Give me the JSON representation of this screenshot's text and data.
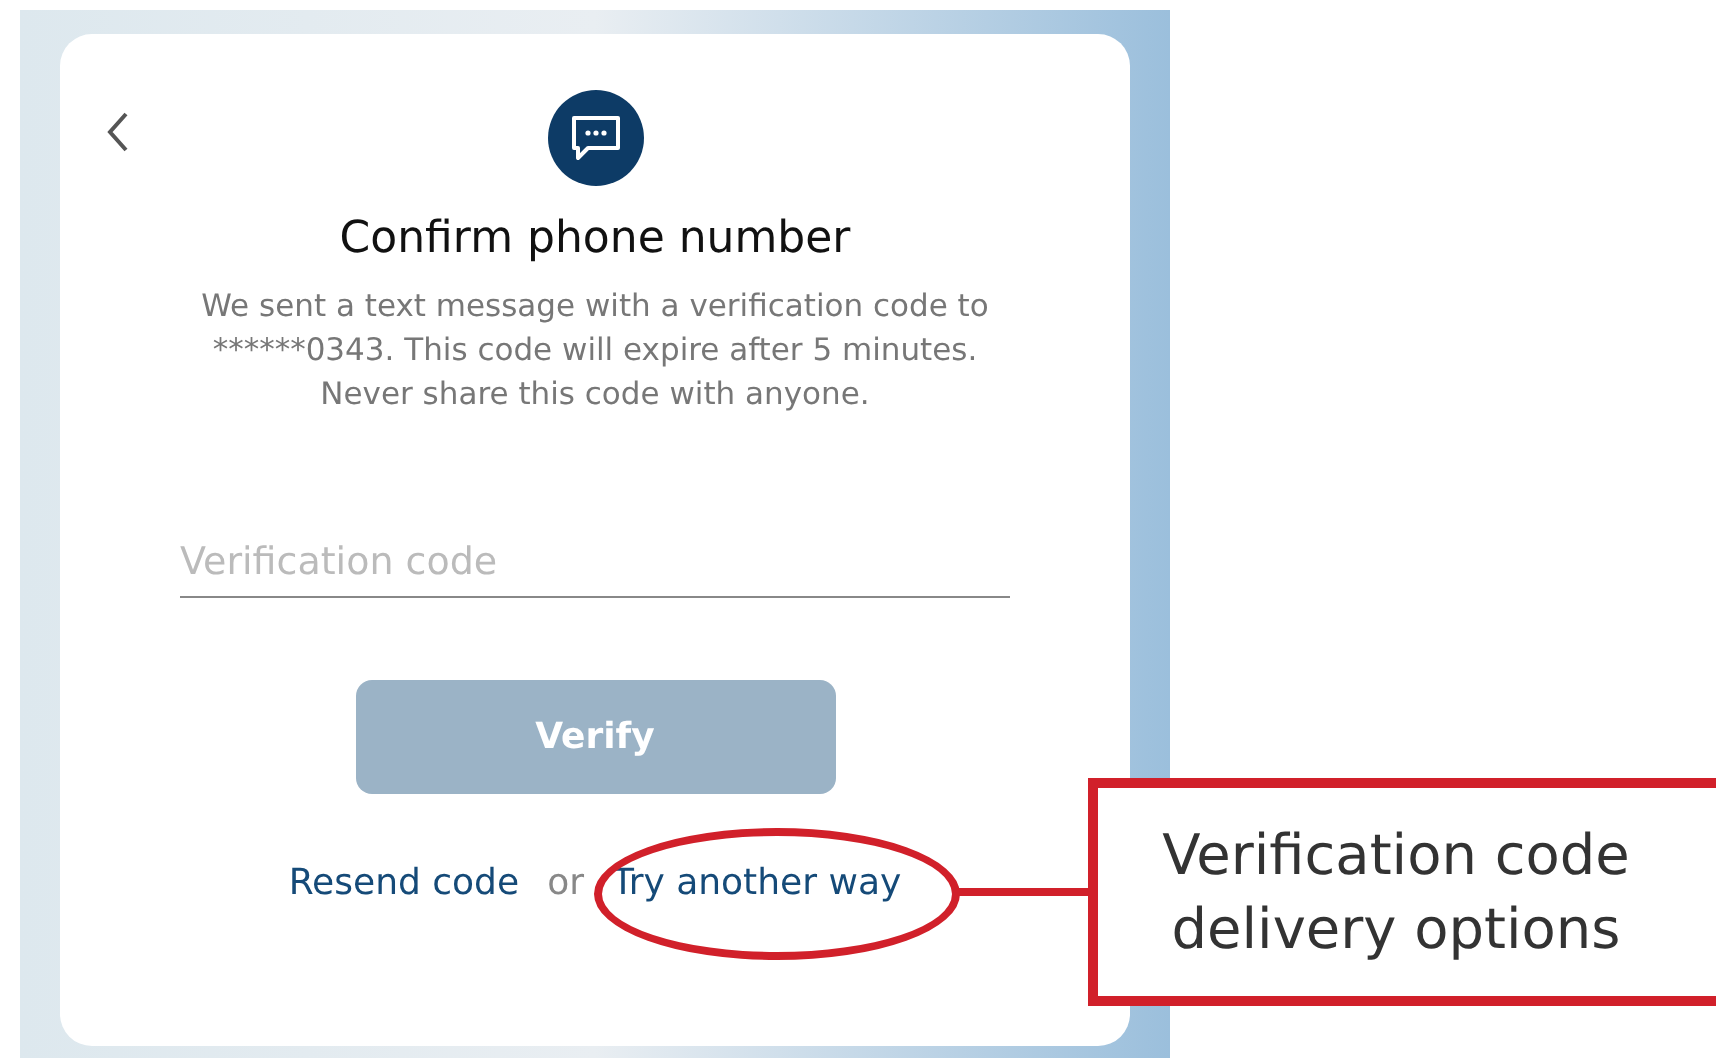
{
  "dialog": {
    "title": "Confirm phone number",
    "message": "We sent a text message with a verification code to ******0343. This code will expire after 5 minutes. Never share this code with anyone.",
    "code_field": {
      "placeholder": "Verification code"
    },
    "verify_button": {
      "label": "Verify",
      "disabled": true
    },
    "resend_link": "Resend code",
    "separator": "or",
    "alternate_link": "Try another way"
  },
  "annotation": {
    "text": "Verification code delivery options"
  }
}
